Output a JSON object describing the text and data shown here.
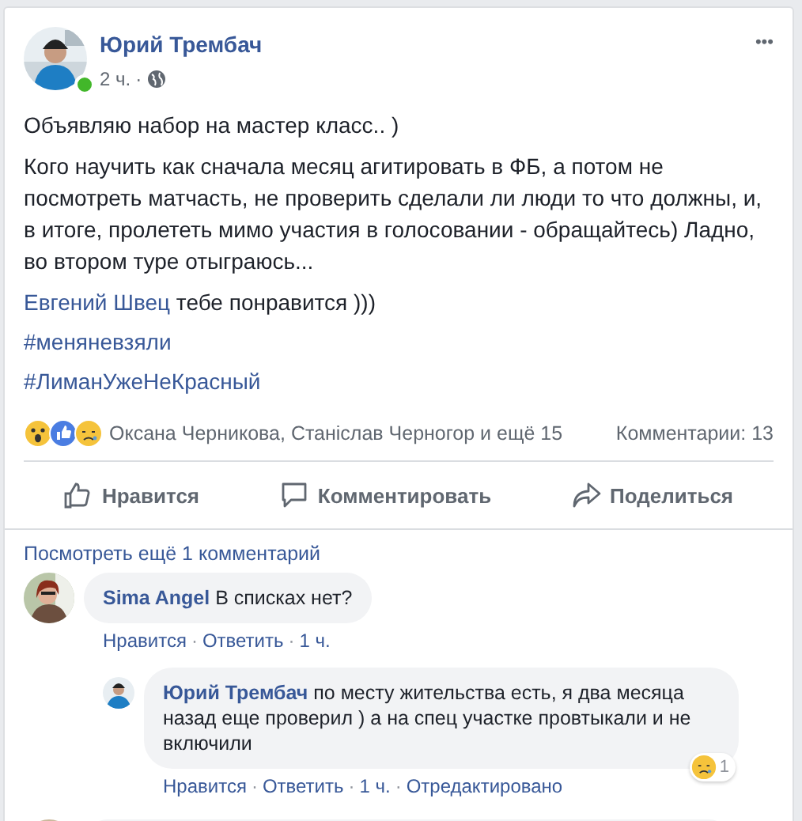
{
  "post": {
    "author": "Юрий Трембач",
    "online": true,
    "time": "2 ч.",
    "separator": "·",
    "menu": "•••",
    "paragraphs": [
      "Объявляю набор на мастер класс.. )",
      "Кого научить как сначала месяц агитировать в ФБ, а потом не посмотреть матчасть, не проверить сделали ли люди то что должны, и, в итоге, пролететь мимо участия в голосовании - обращайтесь) Ладно, во втором туре отыграюсь..."
    ],
    "mention": {
      "name": "Евгений Швец",
      "text": " тебе понравится )))"
    },
    "hashtags": [
      "#меняневзяли",
      "#ЛиманУжеНеКрасный"
    ]
  },
  "reactions": {
    "icons": [
      {
        "kind": "wow"
      },
      {
        "kind": "like"
      },
      {
        "kind": "sad"
      }
    ],
    "names": "Оксана Черникова, Станіслав Черногор и ещё 15",
    "comments": "Комментарии: 13"
  },
  "actions": [
    {
      "kind": "like",
      "label": "Нравится"
    },
    {
      "kind": "comment",
      "label": "Комментировать"
    },
    {
      "kind": "share",
      "label": "Поделиться"
    }
  ],
  "more_comments": "Посмотреть ещё 1 комментарий",
  "comments": [
    {
      "author": "Sima Angel",
      "text": "В списках нет?",
      "separator": "·",
      "links": [
        "Нравится",
        "Ответить",
        "1 ч."
      ],
      "replies": [
        {
          "author": "Юрий Трембач",
          "separator": "·",
          "text": "по месту жительства есть, я два месяца назад еще проверил ) а на спец участке провтыкали и не включили",
          "links": [
            "Нравится",
            "Ответить",
            "1 ч.",
            "Отредактировано"
          ],
          "reaction": {
            "kind": "sad",
            "count": "1"
          }
        }
      ]
    }
  ]
}
